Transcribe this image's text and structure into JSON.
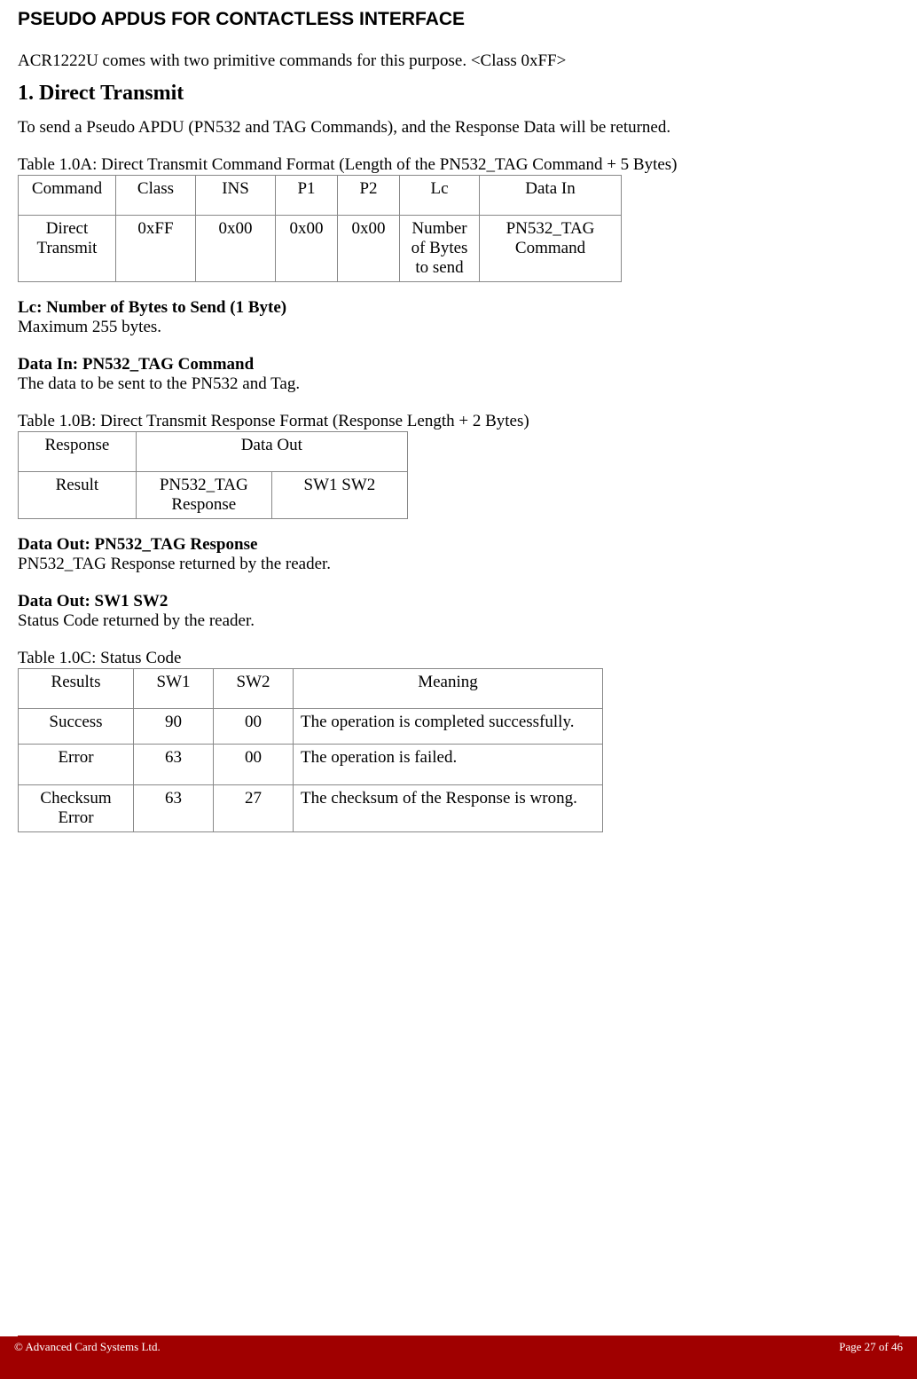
{
  "pageTitle": "PSEUDO APDUS FOR CONTACTLESS INTERFACE",
  "intro": "ACR1222U comes with two primitive commands for this purpose. <Class 0xFF>",
  "sectionHeading": "1. Direct Transmit",
  "sectionBody": "To send a Pseudo APDU (PN532 and TAG Commands), and the Response Data will be returned.",
  "tableA": {
    "caption": "Table 1.0A: Direct Transmit Command Format (Length of the PN532_TAG Command + 5 Bytes)",
    "headers": [
      "Command",
      "Class",
      "INS",
      "P1",
      "P2",
      "Lc",
      "Data In"
    ],
    "row": [
      "Direct Transmit",
      "0xFF",
      "0x00",
      "0x00",
      "0x00",
      "Number of Bytes to send",
      "PN532_TAG Command"
    ]
  },
  "fieldLc": {
    "label": "Lc: Number of Bytes to Send (1 Byte)",
    "desc": "Maximum 255 bytes."
  },
  "fieldDataIn": {
    "label": "Data In: PN532_TAG Command",
    "desc": "The data to be sent to the PN532 and Tag."
  },
  "tableB": {
    "caption": "Table 1.0B: Direct Transmit Response Format (Response Length + 2 Bytes)",
    "headers": [
      "Response",
      "Data Out"
    ],
    "row": [
      "Result",
      "PN532_TAG Response",
      "SW1 SW2"
    ]
  },
  "fieldDataOut1": {
    "label": "Data Out: PN532_TAG Response",
    "desc": "PN532_TAG Response returned by the reader."
  },
  "fieldDataOut2": {
    "label": "Data Out: SW1 SW2",
    "desc": "Status Code returned by the reader."
  },
  "tableC": {
    "caption": "Table 1.0C: Status Code",
    "headers": [
      "Results",
      "SW1",
      "SW2",
      "Meaning"
    ],
    "rows": [
      [
        "Success",
        "90",
        "00",
        "The operation is completed successfully."
      ],
      [
        "Error",
        "63",
        "00",
        "The operation is failed."
      ],
      [
        "Checksum Error",
        "63",
        "27",
        "The checksum of the Response is wrong."
      ]
    ]
  },
  "footer": {
    "left": "© Advanced Card Systems Ltd.",
    "right": "Page 27 of 46"
  }
}
